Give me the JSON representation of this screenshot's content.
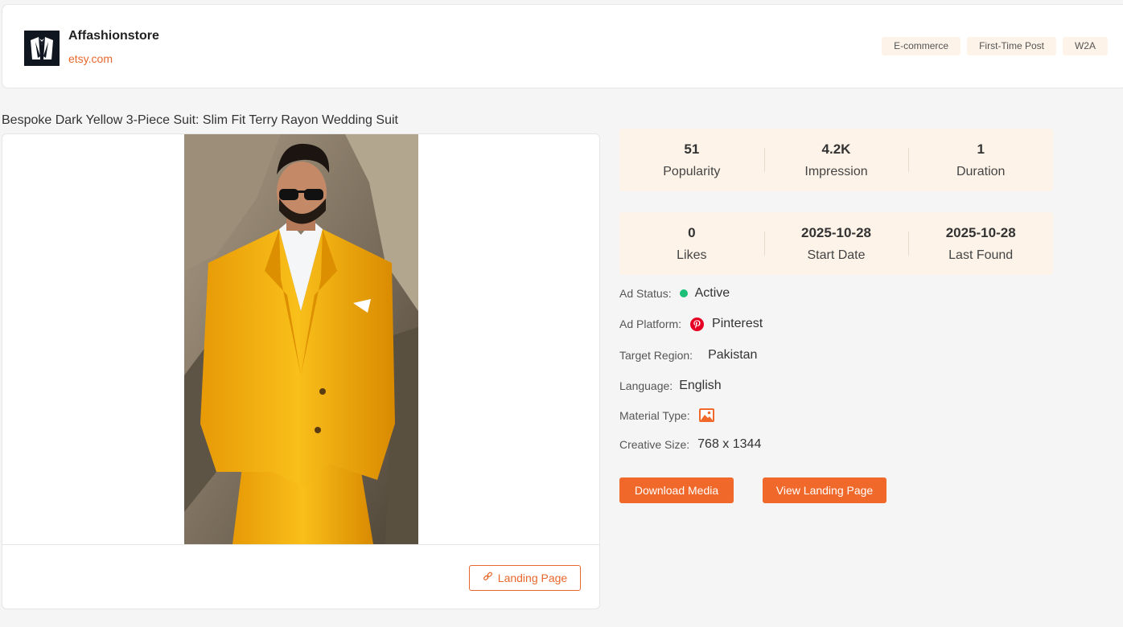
{
  "advertiser": {
    "name": "Affashionstore",
    "domain": "etsy.com",
    "logo_icon": "tuxedo-logo-icon"
  },
  "tags": [
    "E-commerce",
    "First-Time Post",
    "W2A"
  ],
  "ad": {
    "title": "Bespoke Dark Yellow 3-Piece Suit: Slim Fit Terry Rayon Wedding Suit",
    "landing_page_label": "Landing Page"
  },
  "stats": [
    {
      "value": "51",
      "label": "Popularity"
    },
    {
      "value": "4.2K",
      "label": "Impression"
    },
    {
      "value": "1",
      "label": "Duration"
    },
    {
      "value": "0",
      "label": "Likes"
    },
    {
      "value": "2025-10-28",
      "label": "Start Date"
    },
    {
      "value": "2025-10-28",
      "label": "Last Found"
    }
  ],
  "details": {
    "status_label": "Ad Status:",
    "status_value": "Active",
    "status_color": "#1cbf78",
    "platform_label": "Ad Platform:",
    "platform_value": "Pinterest",
    "platform_icon": "pinterest-icon",
    "region_label": "Target Region:",
    "region_value": "Pakistan",
    "language_label": "Language:",
    "language_value": "English",
    "material_label": "Material Type:",
    "material_icon": "image-icon",
    "size_label": "Creative Size:",
    "size_value": "768 x 1344"
  },
  "actions": {
    "download": "Download Media",
    "view_landing": "View Landing Page"
  },
  "colors": {
    "accent": "#f0692a",
    "tag_bg": "#fdf3e8",
    "pinterest": "#e60023"
  }
}
